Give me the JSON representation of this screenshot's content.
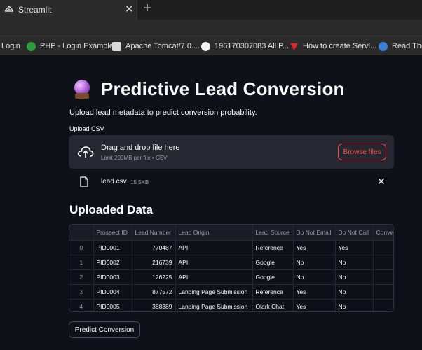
{
  "browser": {
    "tab_title": "Streamlit",
    "tab_close": "✕",
    "new_tab": "+",
    "bookmarks": [
      {
        "label": "Login",
        "icon": "none"
      },
      {
        "label": "PHP - Login Example",
        "icon": "green-tree-icon"
      },
      {
        "label": "Apache Tomcat/7.0....",
        "icon": "tomcat-icon"
      },
      {
        "label": "196170307083 All P...",
        "icon": "github-icon"
      },
      {
        "label": "How to create Servl...",
        "icon": "red-v-icon"
      },
      {
        "label": "Read The",
        "icon": "globe-icon"
      }
    ]
  },
  "app": {
    "title": "Predictive Lead Conversion",
    "subtitle": "Upload lead metadata to predict conversion probability.",
    "upload": {
      "label": "Upload CSV",
      "drag_text": "Drag and drop file here",
      "limit_text": "Limit 200MB per file • CSV",
      "browse_label": "Browse files"
    },
    "file": {
      "name": "lead.csv",
      "size": "15.5KB",
      "close": "✕"
    },
    "section_title": "Uploaded Data",
    "table": {
      "columns": [
        "",
        "Prospect ID",
        "Lead Number",
        "Lead Origin",
        "Lead Source",
        "Do Not Email",
        "Do Not Call",
        "Conve"
      ],
      "rows": [
        [
          "0",
          "PID0001",
          "770487",
          "API",
          "Reference",
          "Yes",
          "Yes",
          ""
        ],
        [
          "1",
          "PID0002",
          "216739",
          "API",
          "Google",
          "No",
          "No",
          ""
        ],
        [
          "2",
          "PID0003",
          "126225",
          "API",
          "Google",
          "No",
          "No",
          ""
        ],
        [
          "3",
          "PID0004",
          "877572",
          "Landing Page Submission",
          "Reference",
          "Yes",
          "No",
          ""
        ],
        [
          "4",
          "PID0005",
          "388389",
          "Landing Page Submission",
          "Olark Chat",
          "Yes",
          "No",
          ""
        ]
      ]
    },
    "predict_label": "Predict Conversion"
  },
  "colors": {
    "background": "#0e1117",
    "accent": "#ff4b4b",
    "widget_bg": "#262730"
  }
}
